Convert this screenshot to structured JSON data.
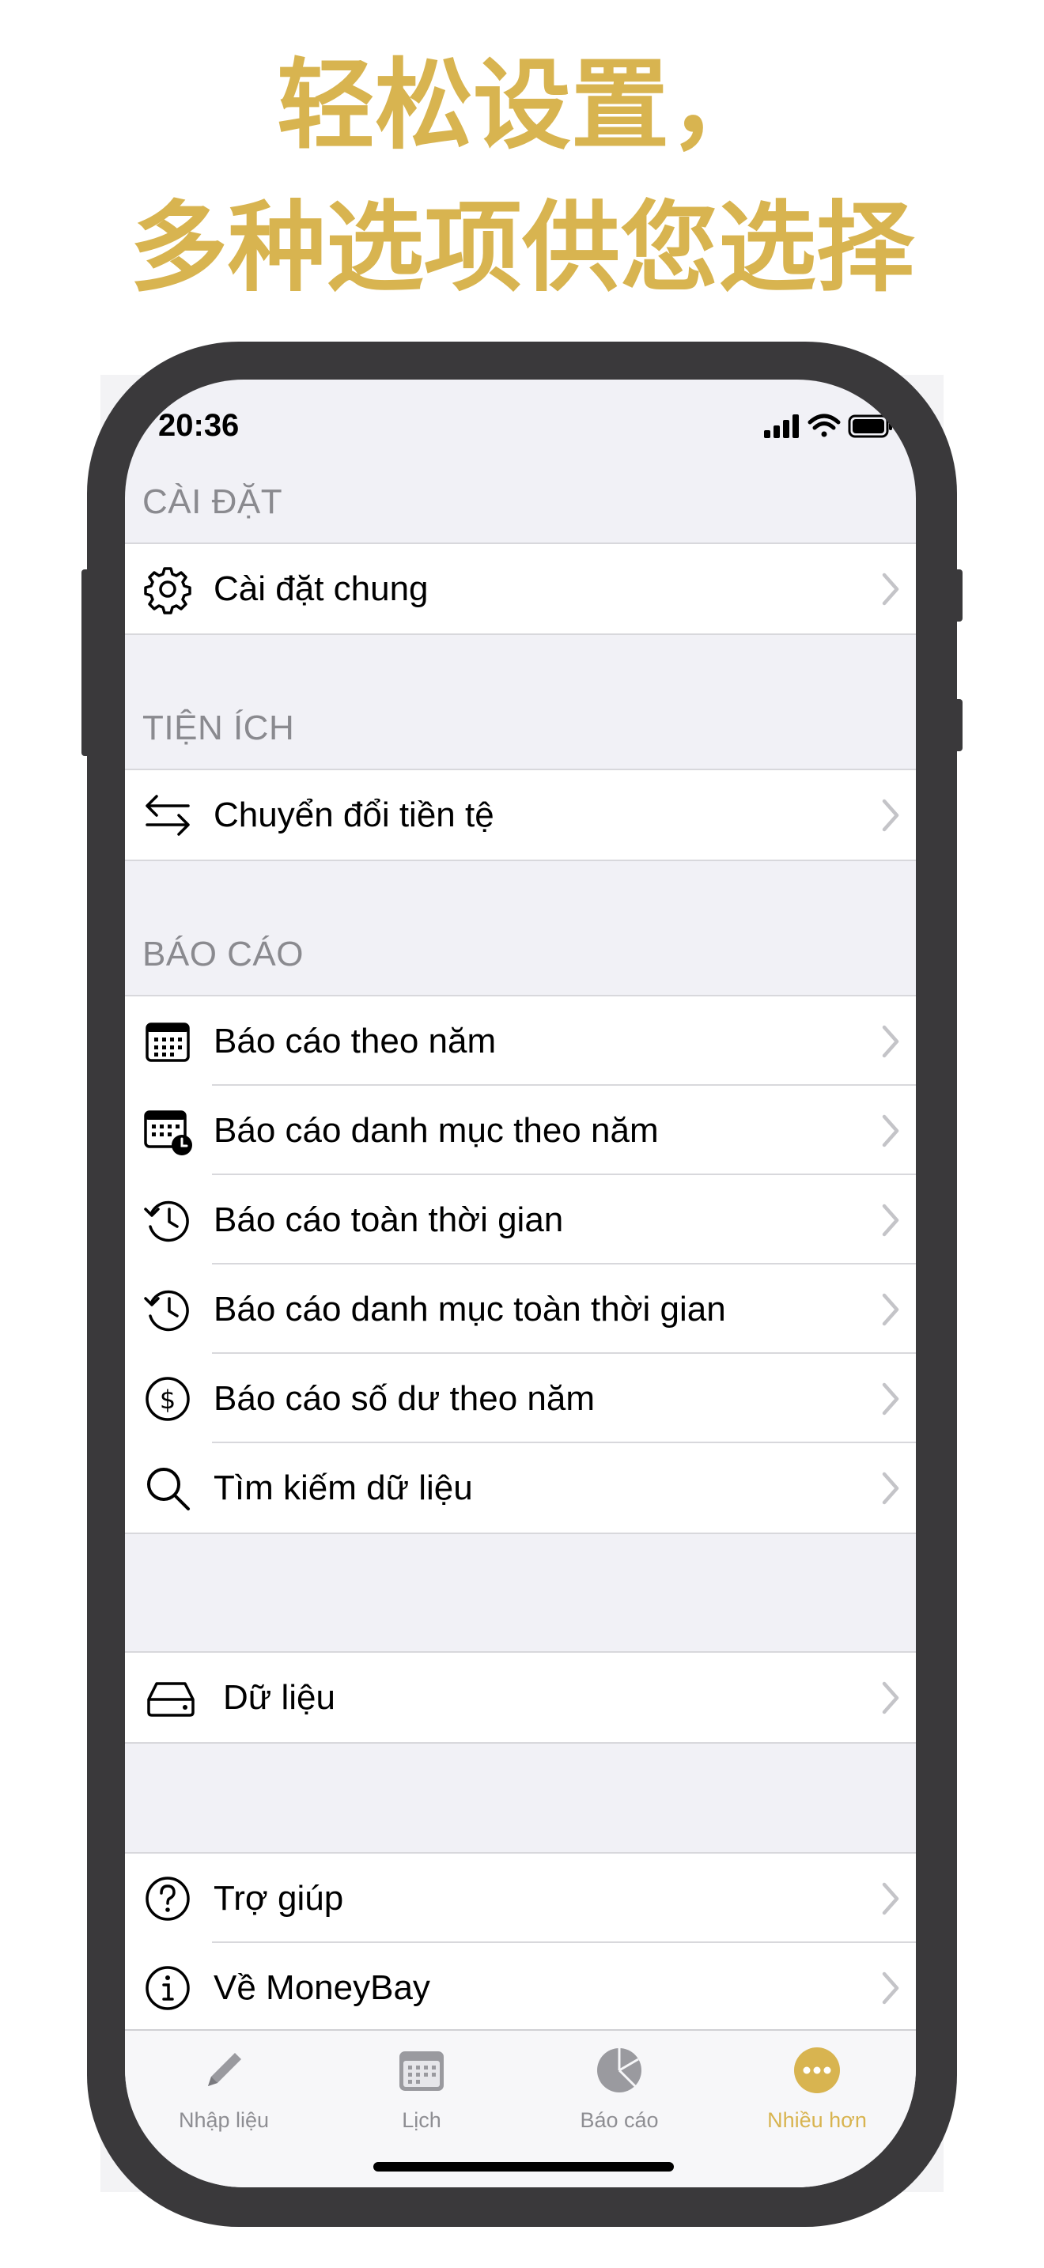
{
  "headline": {
    "line1": "轻松设置，",
    "line2": "多种选项供您选择"
  },
  "status_bar": {
    "time": "20:36"
  },
  "sections": {
    "settings": {
      "header": "CÀI ĐẶT",
      "items": [
        {
          "label": "Cài đặt chung",
          "icon": "gear-icon"
        }
      ]
    },
    "utilities": {
      "header": "TIỆN ÍCH",
      "items": [
        {
          "label": "Chuyển đổi tiền tệ",
          "icon": "arrows-swap-icon"
        }
      ]
    },
    "reports": {
      "header": "BÁO CÁO",
      "items": [
        {
          "label": "Báo cáo theo năm",
          "icon": "calendar-icon"
        },
        {
          "label": "Báo cáo danh mục theo năm",
          "icon": "calendar-clock-icon"
        },
        {
          "label": "Báo cáo toàn thời gian",
          "icon": "history-icon"
        },
        {
          "label": "Báo cáo danh mục toàn thời gian",
          "icon": "history-icon"
        },
        {
          "label": "Báo cáo số dư theo năm",
          "icon": "dollar-circle-icon"
        },
        {
          "label": "Tìm kiếm dữ liệu",
          "icon": "search-icon"
        }
      ]
    },
    "data": {
      "items": [
        {
          "label": "Dữ liệu",
          "icon": "drive-icon"
        }
      ]
    },
    "support": {
      "items": [
        {
          "label": "Trợ giúp",
          "icon": "question-circle-icon"
        },
        {
          "label": "Về MoneyBay",
          "icon": "info-circle-icon"
        }
      ]
    }
  },
  "tab_bar": {
    "tabs": [
      {
        "label": "Nhập liệu",
        "icon": "pencil-icon",
        "active": false
      },
      {
        "label": "Lịch",
        "icon": "calendar-icon",
        "active": false
      },
      {
        "label": "Báo cáo",
        "icon": "pie-chart-icon",
        "active": false
      },
      {
        "label": "Nhiều hơn",
        "icon": "more-icon",
        "active": true
      }
    ]
  },
  "colors": {
    "accent": "#d8b450",
    "phone_frame": "#3a393b",
    "grouped_background": "#f1f1f6",
    "section_header_text": "#8a8a8f",
    "chevron": "#c4c4c8"
  }
}
